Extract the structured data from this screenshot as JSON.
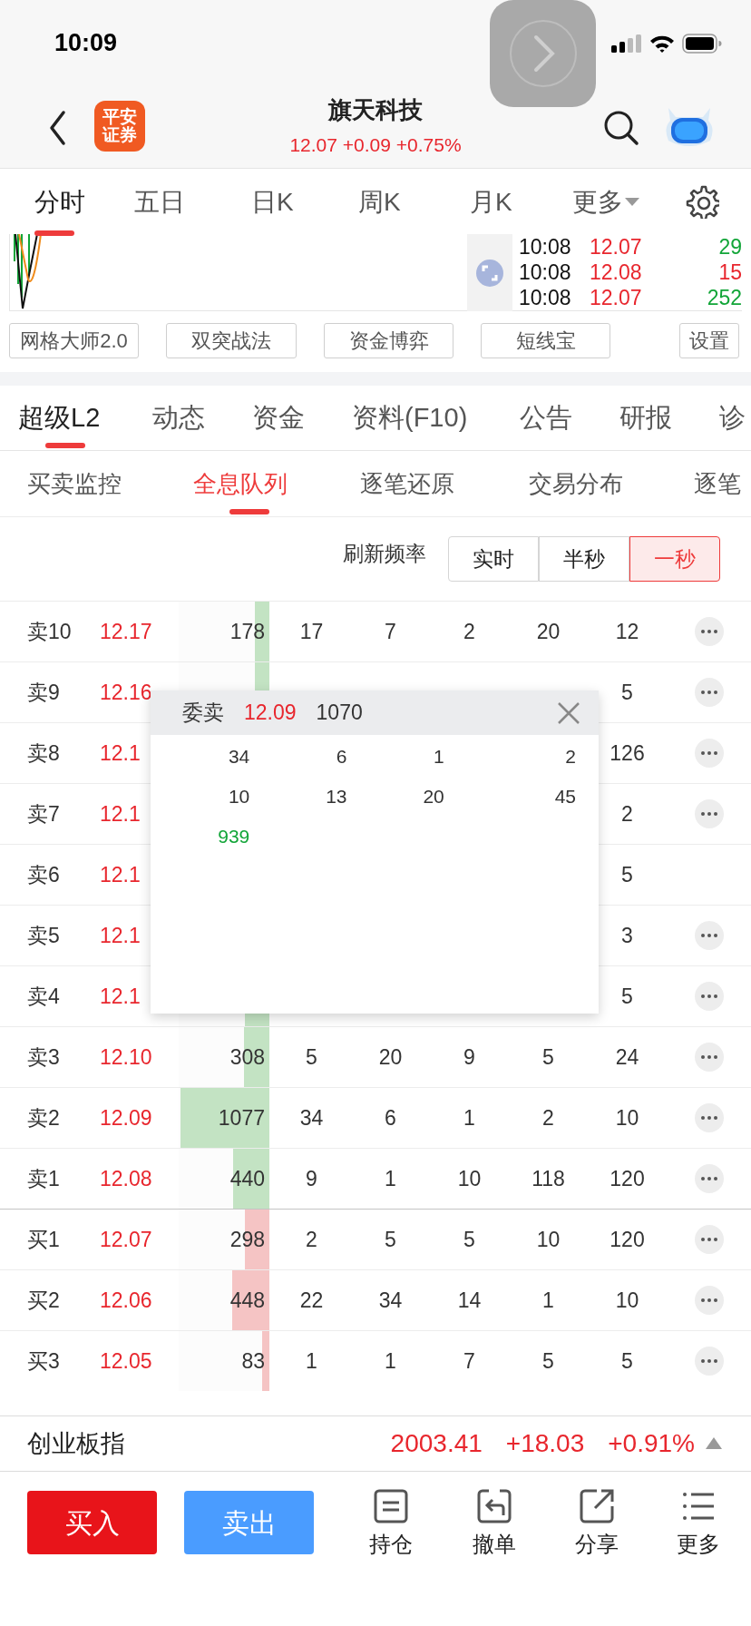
{
  "status_bar": {
    "time": "10:09"
  },
  "header": {
    "logo": [
      "平安",
      "证券"
    ],
    "title": "旗天科技",
    "quote": "12.07 +0.09 +0.75%"
  },
  "chart_tabs": [
    {
      "label": "分时",
      "selected": true
    },
    {
      "label": "五日",
      "selected": false
    },
    {
      "label": "日K",
      "selected": false
    },
    {
      "label": "周K",
      "selected": false
    },
    {
      "label": "月K",
      "selected": false
    },
    {
      "label": "更多",
      "selected": false,
      "kind": "dropdown"
    }
  ],
  "ticks": [
    {
      "time": "10:08",
      "price": "12.07",
      "volume": "29",
      "color": "#12a538"
    },
    {
      "time": "10:08",
      "price": "12.08",
      "volume": "15",
      "color": "#e8262d"
    },
    {
      "time": "10:08",
      "price": "12.07",
      "volume": "252",
      "color": "#12a538"
    }
  ],
  "tools": [
    "网格大师2.0",
    "双突战法",
    "资金博弈",
    "短线宝",
    "设置"
  ],
  "info_tabs": [
    {
      "label": "超级L2",
      "selected": true
    },
    {
      "label": "动态",
      "selected": false
    },
    {
      "label": "资金",
      "selected": false
    },
    {
      "label": "资料(F10)",
      "selected": false
    },
    {
      "label": "公告",
      "selected": false
    },
    {
      "label": "研报",
      "selected": false
    },
    {
      "label": "诊",
      "selected": false
    }
  ],
  "sub_tabs": [
    {
      "label": "买卖监控",
      "selected": false
    },
    {
      "label": "全息队列",
      "selected": true
    },
    {
      "label": "逐笔还原",
      "selected": false
    },
    {
      "label": "交易分布",
      "selected": false
    },
    {
      "label": "逐笔",
      "selected": false
    }
  ],
  "refresh": {
    "label": "刷新频率",
    "options": [
      {
        "label": "实时",
        "selected": false
      },
      {
        "label": "半秒",
        "selected": false
      },
      {
        "label": "一秒",
        "selected": true
      }
    ]
  },
  "order_book": {
    "rows": [
      {
        "kind": "sell",
        "label": "卖10",
        "price": "12.17",
        "qty": "178",
        "orders": [
          "17",
          "7",
          "2",
          "20",
          "12"
        ],
        "level": 0.16,
        "more": true
      },
      {
        "kind": "sell",
        "label": "卖9",
        "price": "12.16",
        "order_5": "5",
        "level": 0.16,
        "more": true
      },
      {
        "kind": "sell",
        "label": "卖8",
        "price": "12.1",
        "order_5": "126",
        "more": true
      },
      {
        "kind": "sell",
        "label": "卖7",
        "price": "12.1",
        "order_5": "2",
        "more": true
      },
      {
        "kind": "sell",
        "label": "卖6",
        "price": "12.1",
        "order_5": "5",
        "more": false
      },
      {
        "kind": "sell",
        "label": "卖5",
        "price": "12.1",
        "order_5": "3",
        "more": true
      },
      {
        "kind": "sell",
        "label": "卖4",
        "price": "12.1",
        "order_5": "5",
        "level": 0.27,
        "more": true
      },
      {
        "kind": "sell",
        "label": "卖3",
        "price": "12.10",
        "qty": "308",
        "orders": [
          "5",
          "20",
          "9",
          "5",
          "24"
        ],
        "level": 0.28,
        "more": true
      },
      {
        "kind": "sell",
        "label": "卖2",
        "price": "12.09",
        "qty": "1077",
        "orders": [
          "34",
          "6",
          "1",
          "2",
          "10"
        ],
        "level": 0.98,
        "more": true
      },
      {
        "kind": "sell",
        "label": "卖1",
        "price": "12.08",
        "qty": "440",
        "orders": [
          "9",
          "1",
          "10",
          "118",
          "120"
        ],
        "level": 0.4,
        "more": true
      },
      {
        "kind": "buy",
        "label": "买1",
        "price": "12.07",
        "qty": "298",
        "orders": [
          "2",
          "5",
          "5",
          "10",
          "120"
        ],
        "level": 0.27,
        "more": true
      },
      {
        "kind": "buy",
        "label": "买2",
        "price": "12.06",
        "qty": "448",
        "orders": [
          "22",
          "34",
          "14",
          "1",
          "10"
        ],
        "level": 0.41,
        "more": true
      },
      {
        "kind": "buy",
        "label": "买3",
        "price": "12.05",
        "qty": "83",
        "orders": [
          "1",
          "1",
          "7",
          "5",
          "5"
        ],
        "level": 0.08,
        "more": true
      }
    ]
  },
  "popup": {
    "title": "委卖",
    "price": "12.09",
    "qty": "1070",
    "orders": [
      {
        "value": "34"
      },
      {
        "value": "6"
      },
      {
        "value": "1"
      },
      {
        "value": "2"
      },
      {
        "value": "10"
      },
      {
        "value": "13"
      },
      {
        "value": "20"
      },
      {
        "value": "45"
      },
      {
        "value": "939",
        "color": "#12a538"
      }
    ]
  },
  "index_bar": {
    "name": "创业板指",
    "value": "2003.41",
    "change": "+18.03",
    "percent": "+0.91%"
  },
  "actions": {
    "buy": "买入",
    "sell": "卖出",
    "tools": [
      {
        "kind": "holdings",
        "label": "持仓"
      },
      {
        "kind": "cancel",
        "label": "撤单"
      },
      {
        "kind": "share",
        "label": "分享"
      },
      {
        "kind": "more",
        "label": "更多"
      }
    ]
  }
}
